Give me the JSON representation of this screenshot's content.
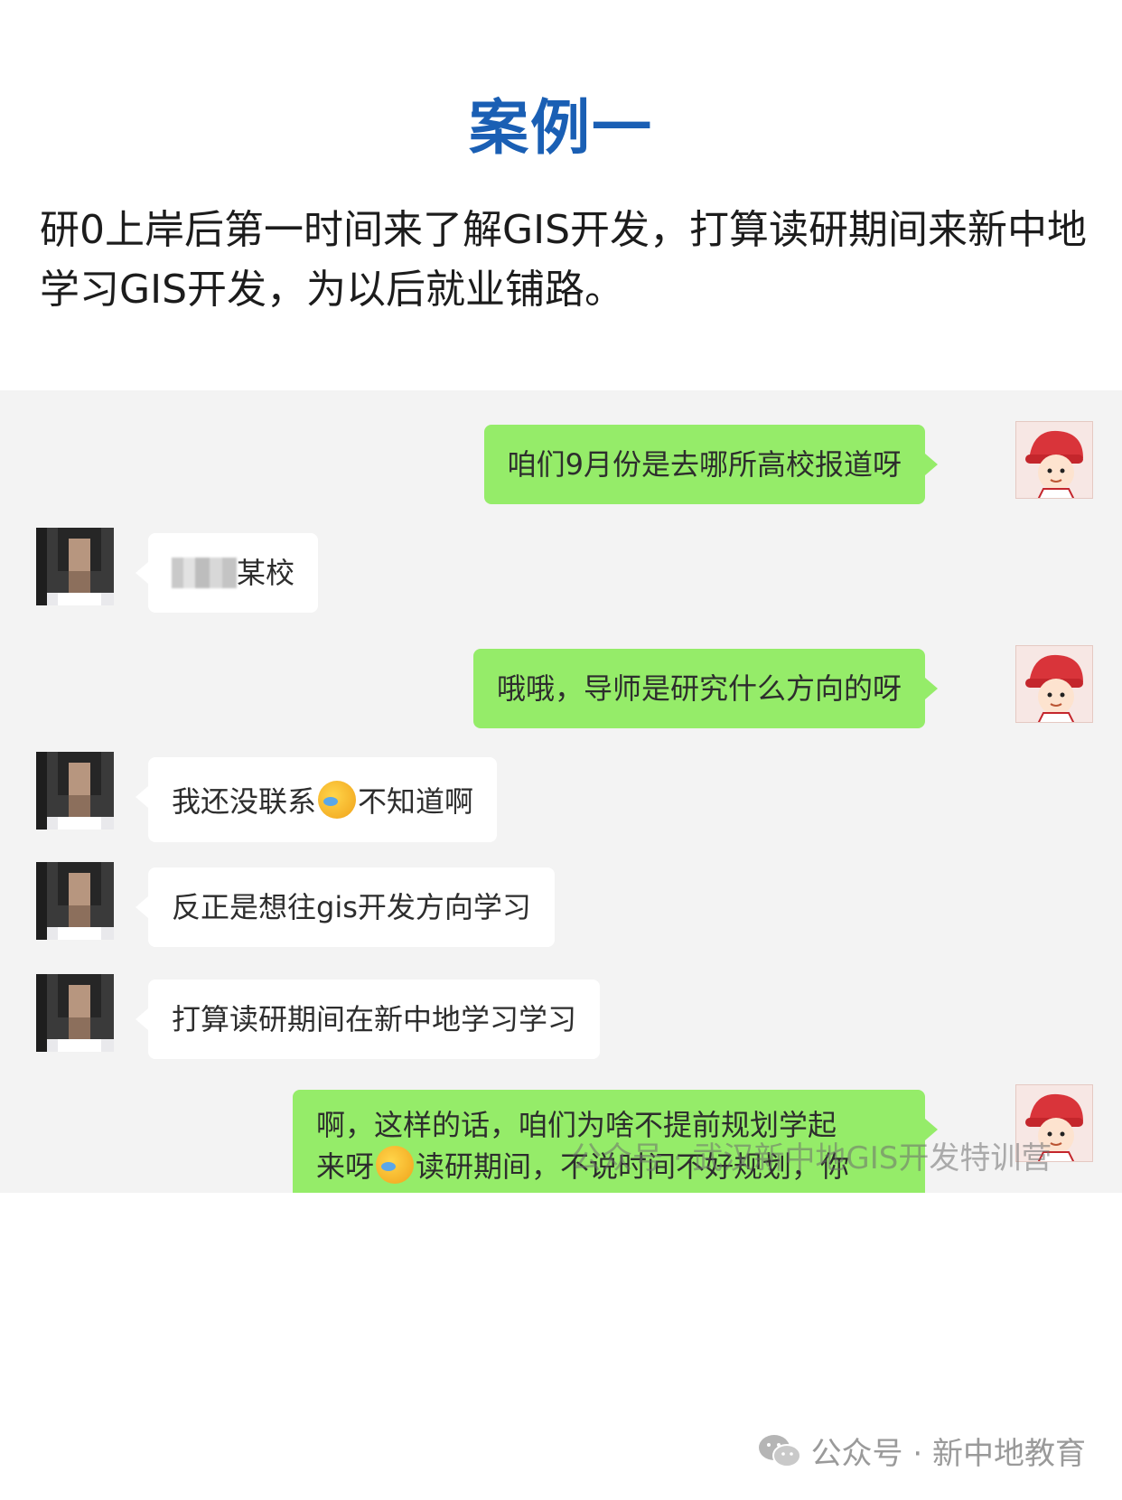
{
  "title": "案例一",
  "intro": "研0上岸后第一时间来了解GIS开发，打算读研期间来新中地学习GIS开发，为以后就业铺路。",
  "messages": [
    {
      "from": "me",
      "text": "咱们9月份是去哪所高校报道呀"
    },
    {
      "from": "them",
      "text": "某校"
    },
    {
      "from": "me",
      "text": "哦哦，导师是研究什么方向的呀"
    },
    {
      "from": "them",
      "text_before": "我还没联系",
      "text_after": "不知道啊"
    },
    {
      "from": "them",
      "text": "反正是想往gis开发方向学习"
    },
    {
      "from": "them",
      "text": "打算读研期间在新中地学习学习"
    },
    {
      "from": "me",
      "line1": "啊，这样的话，咱们为啥不提前规划学起",
      "line2_before": "来呀",
      "line2_after": "读研期间，不说时间不好规划，你"
    }
  ],
  "watermark_mid": "公众号 · 武汉新中地GIS开发特训营",
  "footer": "公众号 · 新中地教育",
  "colors": {
    "title": "#1a5fb4",
    "bubble_me": "#95ec69",
    "bubble_them": "#ffffff",
    "chat_bg": "#f3f3f3"
  }
}
